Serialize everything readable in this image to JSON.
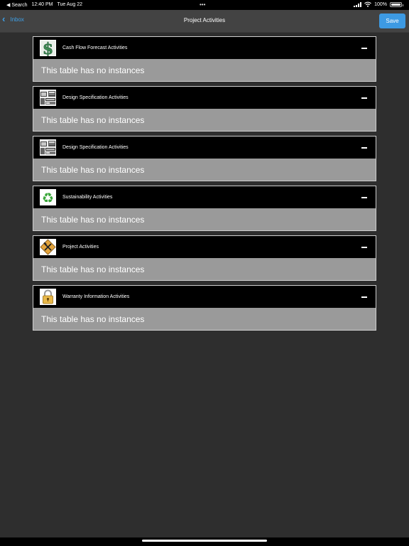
{
  "status_bar": {
    "back_app": "◀ Search",
    "time": "12:40 PM",
    "date": "Tue Aug 22",
    "dots": "•••",
    "battery_pct": "100%"
  },
  "nav": {
    "back_label": "Inbox",
    "title": "Project Activities",
    "save_label": "Save"
  },
  "sections": [
    {
      "title": "Cash Flow Forecast Activities",
      "icon": "dollar-icon",
      "empty_text": "This table has no instances"
    },
    {
      "title": "Design Specification Activities",
      "icon": "blueprint-icon",
      "empty_text": "This table has no instances"
    },
    {
      "title": "Design Specification Activities",
      "icon": "blueprint-icon",
      "empty_text": "This table has no instances"
    },
    {
      "title": "Sustainability Activities",
      "icon": "recycle-icon",
      "empty_text": "This table has no instances"
    },
    {
      "title": "Project Activities",
      "icon": "tools-icon",
      "empty_text": "This table has no instances"
    },
    {
      "title": "Warranty Information Activities",
      "icon": "lock-icon",
      "empty_text": "This table has no instances"
    }
  ],
  "colors": {
    "accent": "#3d9ae3",
    "background": "#2e2e2e",
    "header": "#000000",
    "body": "#9a9a9a"
  }
}
